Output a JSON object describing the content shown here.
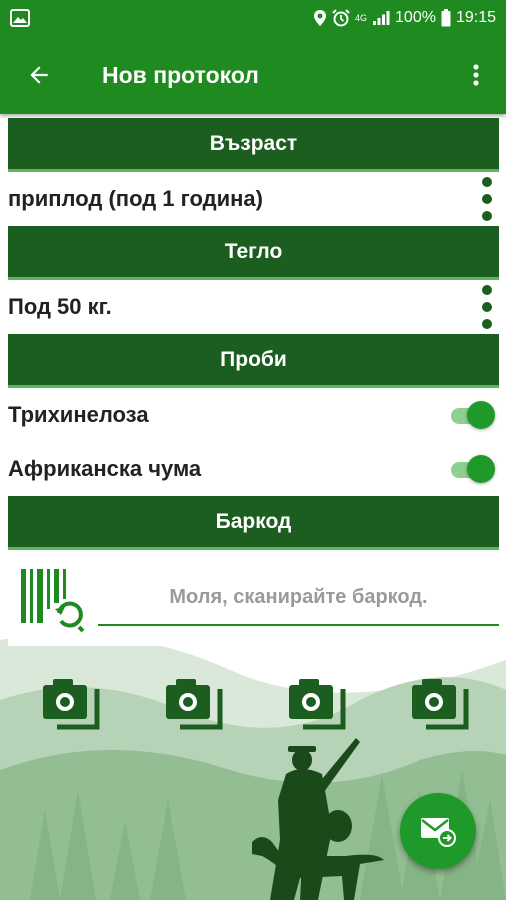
{
  "status_bar": {
    "network": "4G",
    "battery": "100%",
    "time": "19:15"
  },
  "app_bar": {
    "title": "Нов протокол"
  },
  "sections": {
    "age": {
      "header": "Възраст",
      "value": "приплод (под 1 година)"
    },
    "weight": {
      "header": "Тегло",
      "value": "Под 50 кг."
    },
    "samples": {
      "header": "Проби",
      "items": [
        {
          "label": "Трихинелоза",
          "enabled": true
        },
        {
          "label": "Африканска чума",
          "enabled": true
        }
      ]
    },
    "barcode": {
      "header": "Баркод",
      "placeholder": "Моля, сканирайте баркод."
    }
  },
  "colors": {
    "app_bar": "#1f8a1f",
    "header": "#1b5e20",
    "accent": "#1f9a2a"
  }
}
